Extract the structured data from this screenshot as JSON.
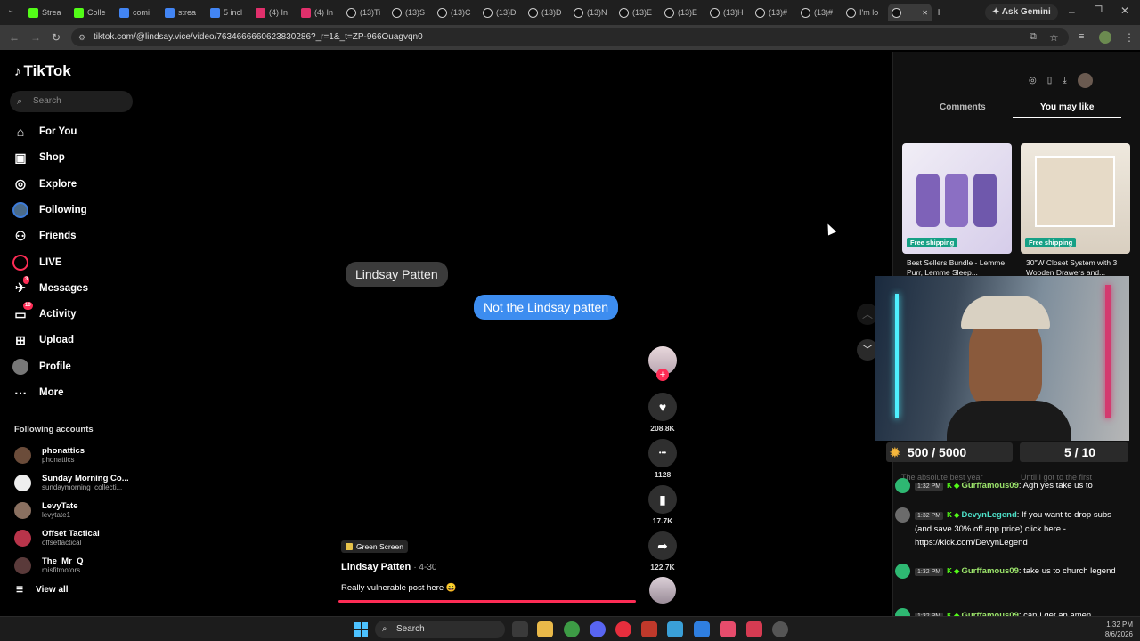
{
  "browser": {
    "tabs": [
      "Strea",
      "Colle",
      "comi",
      "strea",
      "5 incl",
      "(4) In",
      "(4) In",
      "(13)Ti",
      "(13)S",
      "(13)C",
      "(13)D",
      "(13)D",
      "(13)N",
      "(13)E",
      "(13)E",
      "(13)H",
      "(13)#",
      "(13)#",
      "I'm lo",
      ""
    ],
    "ask_gemini": "Ask Gemini",
    "url": "tiktok.com/@lindsay.vice/video/7634666660623830286?_r=1&_t=ZP-966Ouagvqn0"
  },
  "tiktok": {
    "logo": "TikTok",
    "search_placeholder": "Search",
    "nav": [
      {
        "label": "For You",
        "icon": "home-icon"
      },
      {
        "label": "Shop",
        "icon": "shop-icon"
      },
      {
        "label": "Explore",
        "icon": "compass-icon"
      },
      {
        "label": "Following",
        "icon": "following-avatar-icon"
      },
      {
        "label": "Friends",
        "icon": "friends-icon"
      },
      {
        "label": "LIVE",
        "icon": "live-icon"
      },
      {
        "label": "Messages",
        "icon": "messages-icon",
        "badge": "3"
      },
      {
        "label": "Activity",
        "icon": "activity-icon",
        "badge": "10"
      },
      {
        "label": "Upload",
        "icon": "upload-icon"
      },
      {
        "label": "Profile",
        "icon": "profile-avatar-icon"
      },
      {
        "label": "More",
        "icon": "more-icon"
      }
    ],
    "following_title": "Following accounts",
    "accounts": [
      {
        "name": "phonattics",
        "handle": "phonattics",
        "color": "#6b4c3a"
      },
      {
        "name": "Sunday Morning Co...",
        "handle": "sundaymorning_collecti...",
        "color": "#eeeeee"
      },
      {
        "name": "LevyTate",
        "handle": "levytate1",
        "color": "#8a7060"
      },
      {
        "name": "Offset Tactical",
        "handle": "offsettactical",
        "color": "#b8344a"
      },
      {
        "name": "The_Mr_Q",
        "handle": "misfitmotors",
        "color": "#5a3a3a"
      }
    ],
    "view_all": "View all"
  },
  "video": {
    "bubble_grey": "Lindsay Patten",
    "bubble_blue": "Not the Lindsay patten",
    "tag": "Green Screen",
    "author": "Lindsay Patten",
    "date": "4-30",
    "caption": "Really vulnerable post here 😄",
    "likes": "208.8K",
    "comments": "1128",
    "saves": "17.7K",
    "shares": "122.7K"
  },
  "right": {
    "tab_comments": "Comments",
    "tab_you_may_like": "You may like",
    "products": [
      {
        "badge": "Free shipping",
        "title": "Best Sellers Bundle - Lemme Purr, Lemme Sleep..."
      },
      {
        "badge": "Free shipping",
        "title": "30\"W Closet System with 3 Wooden Drawers and..."
      }
    ]
  },
  "stream": {
    "counter_left": "500 / 5000",
    "counter_right": "5 / 10",
    "overlay_a": "The absolute best year",
    "overlay_b": "Until I got to the first",
    "chat": [
      {
        "time": "1:32 PM",
        "user": "Gurffamous09",
        "text": ": Agh yes take us to",
        "user_color": "#9be36b"
      },
      {
        "time": "1:32 PM",
        "user": "DevynLegend",
        "text": ": If you want to drop subs (and save 30% off app price) click here - https://kick.com/DevynLegend",
        "user_color": "#4de0c8"
      },
      {
        "time": "1:32 PM",
        "user": "Gurffamous09",
        "text": ": take us to church legend",
        "user_color": "#9be36b"
      },
      {
        "time": "1:32 PM",
        "user": "Gurffamous09",
        "text": ": can I get an amen",
        "user_color": "#9be36b"
      }
    ]
  },
  "taskbar": {
    "search": "Search",
    "time": "1:32 PM",
    "date": "8/6/2026"
  }
}
